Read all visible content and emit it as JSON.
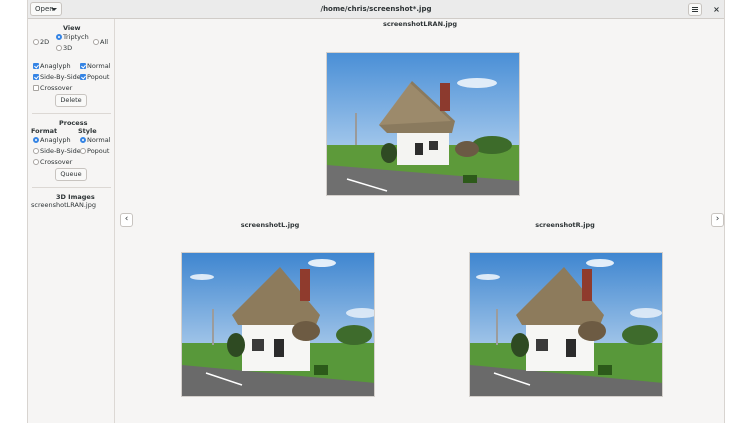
{
  "header": {
    "open_label": "Open",
    "title": "/home/chris/screenshot*.jpg",
    "close_glyph": "×"
  },
  "sidebar": {
    "view": {
      "heading": "View",
      "options": {
        "d2": "2D",
        "triptych": "Triptych",
        "all": "All",
        "d3": "3D"
      },
      "selected": "Triptych"
    },
    "checks": {
      "anaglyph": "Anaglyph",
      "normal": "Normal",
      "side_by_side": "Side-By-Side",
      "popout": "Popout",
      "crossover": "Crossover"
    },
    "delete_label": "Delete",
    "process": {
      "heading": "Process",
      "format_heading": "Format",
      "style_heading": "Style",
      "format_anaglyph": "Anaglyph",
      "format_sbs": "Side-By-Side",
      "format_crossover": "Crossover",
      "style_normal": "Normal",
      "style_popout": "Popout",
      "queue_label": "Queue"
    },
    "images3d": {
      "heading": "3D Images",
      "items": [
        "screenshotLRAN.jpg"
      ]
    }
  },
  "main": {
    "top_image_name": "screenshotLRAN.jpg",
    "left_image_name": "screenshotL.jpg",
    "right_image_name": "screenshotR.jpg",
    "prev_glyph": "‹",
    "next_glyph": "›"
  },
  "icons": {
    "open": "chevron-down-icon",
    "menu": "hamburger-menu-icon",
    "close": "close-icon",
    "prev": "chevron-left-icon",
    "next": "chevron-right-icon"
  },
  "colors": {
    "accent": "#3584e4",
    "background": "#f6f5f4"
  }
}
